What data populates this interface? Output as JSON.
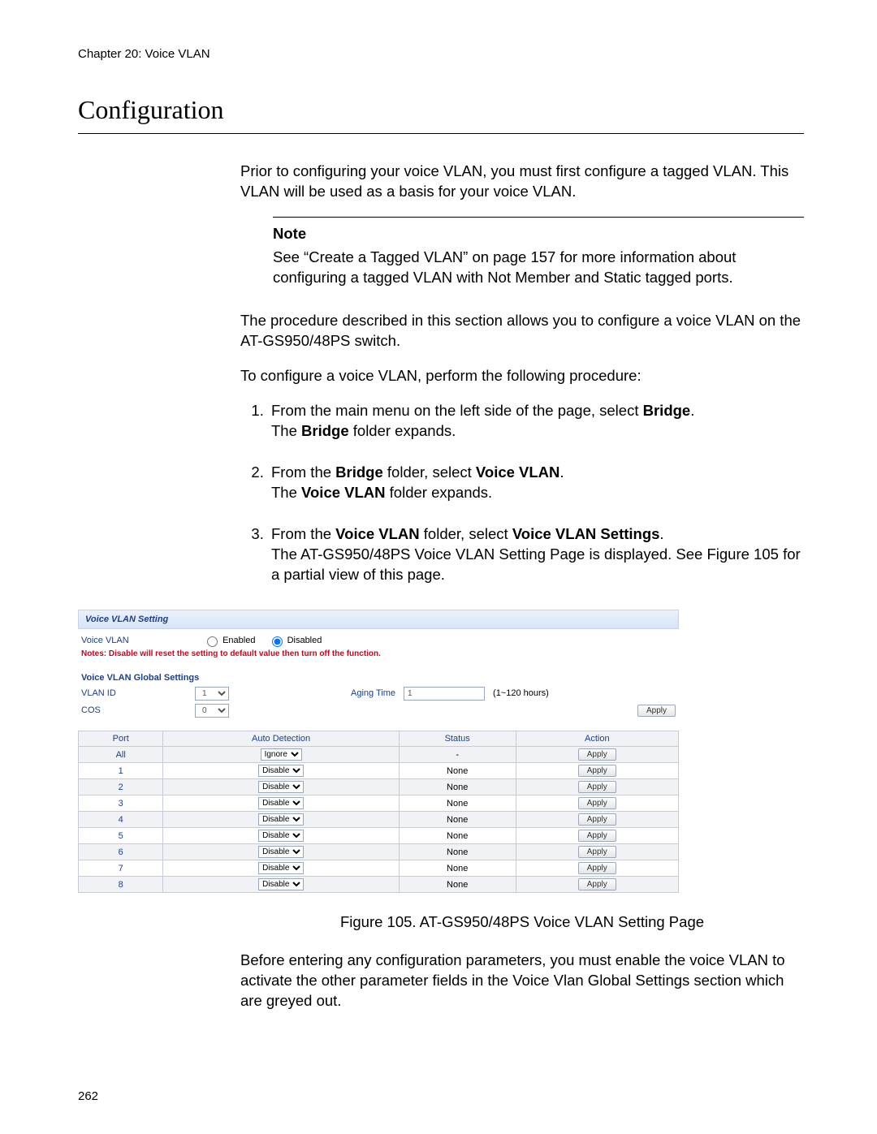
{
  "header": {
    "chapter_line": "Chapter 20: Voice VLAN"
  },
  "title": "Configuration",
  "page_number": "262",
  "prose": {
    "intro": "Prior to configuring your voice VLAN, you must first configure a tagged VLAN. This VLAN will be used as a basis for your voice VLAN.",
    "note_label": "Note",
    "note_body": "See “Create a Tagged VLAN” on page 157 for more information about configuring a tagged VLAN with Not Member and Static tagged ports.",
    "para2": "The procedure described in this section allows you to configure a voice VLAN on the AT-GS950/48PS switch.",
    "para3": "To configure a voice VLAN, perform the following procedure:",
    "steps": {
      "s1a": "From the main menu on the left side of the page, select ",
      "s1b": "Bridge",
      "s1c": ".",
      "s1d": "The ",
      "s1e": "Bridge",
      "s1f": " folder expands.",
      "s2a": "From the ",
      "s2b": "Bridge",
      "s2c": " folder, select ",
      "s2d": "Voice VLAN",
      "s2e": ".",
      "s2f": "The ",
      "s2g": "Voice VLAN",
      "s2h": " folder expands.",
      "s3a": "From the ",
      "s3b": "Voice VLAN",
      "s3c": " folder, select ",
      "s3d": "Voice VLAN Settings",
      "s3e": ".",
      "s3f": "The AT-GS950/48PS Voice VLAN Setting Page is displayed. See Figure 105 for a partial view of this page."
    },
    "caption": "Figure 105. AT-GS950/48PS Voice VLAN Setting Page",
    "after_fig": "Before entering any configuration parameters, you must enable the voice VLAN to activate the other parameter fields in the Voice Vlan Global Settings section which are greyed out."
  },
  "embedded": {
    "panel_title": "Voice VLAN Setting",
    "voice_vlan_label": "Voice VLAN",
    "enabled_label": "Enabled",
    "disabled_label": "Disabled",
    "warning": "Notes: Disable will reset the setting to default value then turn off the function.",
    "global_hdr": "Voice VLAN Global Settings",
    "vlan_id_label": "VLAN ID",
    "vlan_id_value": "1",
    "aging_label": "Aging Time",
    "aging_value": "1",
    "aging_hint": "(1~120 hours)",
    "cos_label": "COS",
    "cos_value": "0",
    "apply_label": "Apply",
    "columns": {
      "port": "Port",
      "auto": "Auto Detection",
      "status": "Status",
      "action": "Action"
    },
    "rows": [
      {
        "port": "All",
        "auto": "Ignore",
        "status": "-"
      },
      {
        "port": "1",
        "auto": "Disable",
        "status": "None"
      },
      {
        "port": "2",
        "auto": "Disable",
        "status": "None"
      },
      {
        "port": "3",
        "auto": "Disable",
        "status": "None"
      },
      {
        "port": "4",
        "auto": "Disable",
        "status": "None"
      },
      {
        "port": "5",
        "auto": "Disable",
        "status": "None"
      },
      {
        "port": "6",
        "auto": "Disable",
        "status": "None"
      },
      {
        "port": "7",
        "auto": "Disable",
        "status": "None"
      },
      {
        "port": "8",
        "auto": "Disable",
        "status": "None"
      }
    ]
  }
}
